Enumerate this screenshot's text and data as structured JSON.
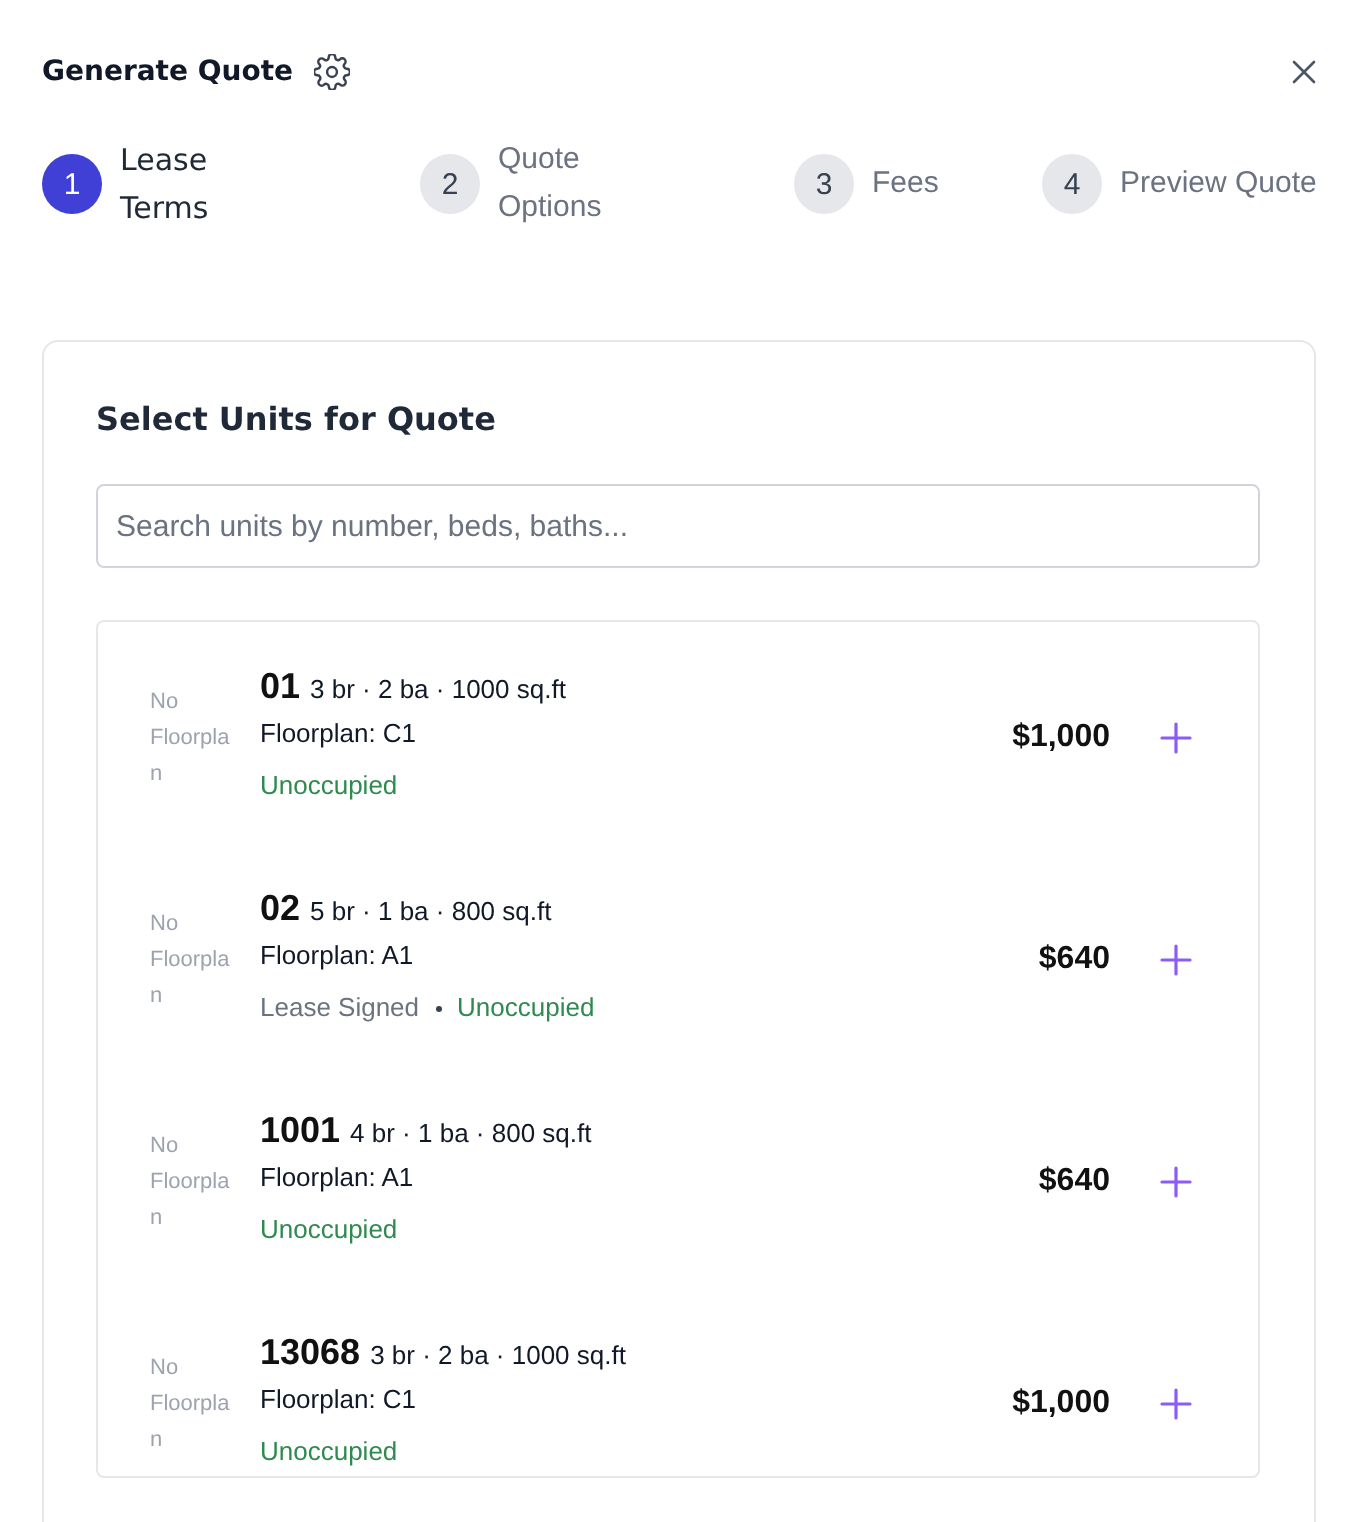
{
  "dialog": {
    "title": "Generate Quote"
  },
  "steps": [
    {
      "number": "1",
      "label": "Lease Terms",
      "selected": true
    },
    {
      "number": "2",
      "label": "Quote Options",
      "selected": false
    },
    {
      "number": "3",
      "label": "Fees",
      "selected": false
    },
    {
      "number": "4",
      "label": "Preview Quote",
      "selected": false
    }
  ],
  "unit_picker": {
    "title": "Select Units for Quote",
    "search": {
      "placeholder": "Search units by number, beds, baths..."
    },
    "units": [
      {
        "thumbnail": "No Floorplan",
        "number": "01",
        "specs": "3 br · 2 ba · 1000 sq.ft",
        "floorplan": "Floorplan: C1",
        "statuses": [
          {
            "label": "Unoccupied",
            "color": "#2f8a4f"
          }
        ],
        "price": "$1,000"
      },
      {
        "thumbnail": "No Floorplan",
        "number": "02",
        "specs": "5 br · 1 ba · 800 sq.ft",
        "floorplan": "Floorplan: A1",
        "statuses": [
          {
            "label": "Lease Signed",
            "color": "#6b7280"
          },
          {
            "label": "Unoccupied",
            "color": "#2f8a4f"
          }
        ],
        "price": "$640"
      },
      {
        "thumbnail": "No Floorplan",
        "number": "1001",
        "specs": "4 br · 1 ba · 800 sq.ft",
        "floorplan": "Floorplan: A1",
        "statuses": [
          {
            "label": "Unoccupied",
            "color": "#2f8a4f"
          }
        ],
        "price": "$640"
      },
      {
        "thumbnail": "No Floorplan",
        "number": "13068",
        "specs": "3 br · 2 ba · 1000 sq.ft",
        "floorplan": "Floorplan: C1",
        "statuses": [
          {
            "label": "Unoccupied",
            "color": "#2f8a4f"
          }
        ],
        "price": "$1,000"
      }
    ]
  }
}
